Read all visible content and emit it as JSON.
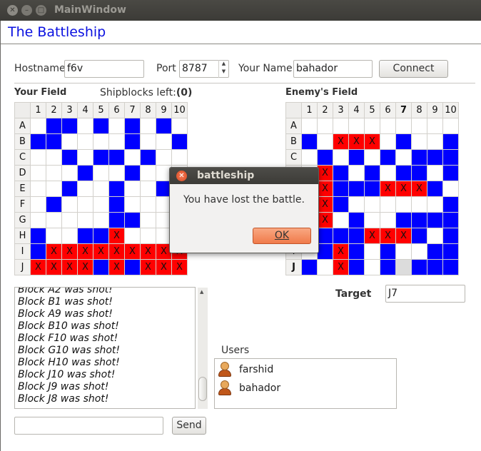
{
  "window": {
    "title": "MainWindow",
    "close_glyph": "✕",
    "min_glyph": "–",
    "max_glyph": "□"
  },
  "app": {
    "title": "The Battleship"
  },
  "connection": {
    "hostname_label": "Hostname",
    "hostname_value": "f6v",
    "port_label": "Port",
    "port_value": "8787",
    "name_label": "Your Name",
    "name_value": "bahador",
    "connect_label": "Connect"
  },
  "your_field": {
    "label": "Your Field",
    "shipblocks_label": "Shipblocks left:",
    "shipblocks_value": "(0)",
    "columns": [
      "1",
      "2",
      "3",
      "4",
      "5",
      "6",
      "7",
      "8",
      "9",
      "10"
    ],
    "rows": [
      "A",
      "B",
      "C",
      "D",
      "E",
      "F",
      "G",
      "H",
      "I",
      "J"
    ],
    "cells": [
      [
        "e",
        "s",
        "s",
        "e",
        "s",
        "e",
        "s",
        "e",
        "s",
        "e"
      ],
      [
        "s",
        "s",
        "e",
        "e",
        "e",
        "e",
        "s",
        "e",
        "e",
        "s"
      ],
      [
        "e",
        "e",
        "s",
        "e",
        "s",
        "s",
        "e",
        "s",
        "e",
        "e"
      ],
      [
        "e",
        "e",
        "e",
        "s",
        "e",
        "e",
        "s",
        "e",
        "e",
        "e"
      ],
      [
        "e",
        "e",
        "s",
        "e",
        "e",
        "s",
        "e",
        "e",
        "s",
        "s"
      ],
      [
        "e",
        "s",
        "e",
        "e",
        "e",
        "s",
        "e",
        "e",
        "e",
        "s"
      ],
      [
        "e",
        "e",
        "e",
        "e",
        "e",
        "s",
        "s",
        "e",
        "e",
        "s"
      ],
      [
        "s",
        "e",
        "e",
        "s",
        "s",
        "h",
        "e",
        "e",
        "e",
        "e"
      ],
      [
        "s",
        "h",
        "h",
        "h",
        "h",
        "h",
        "h",
        "h",
        "h",
        "h"
      ],
      [
        "h",
        "h",
        "h",
        "h",
        "s",
        "h",
        "s",
        "h",
        "h",
        "h"
      ]
    ]
  },
  "enemy_field": {
    "label": "Enemy's Field",
    "columns": [
      "1",
      "2",
      "3",
      "4",
      "5",
      "6",
      "7",
      "8",
      "9",
      "10"
    ],
    "rows": [
      "A",
      "B",
      "C",
      "D",
      "E",
      "F",
      "G",
      "H",
      "I",
      "J"
    ],
    "bold_col": 6,
    "bold_row": 9,
    "cells": [
      [
        "e",
        "e",
        "e",
        "e",
        "e",
        "e",
        "e",
        "e",
        "e",
        "e"
      ],
      [
        "s",
        "e",
        "h",
        "h",
        "h",
        "e",
        "s",
        "e",
        "e",
        "s"
      ],
      [
        "e",
        "s",
        "e",
        "s",
        "e",
        "s",
        "e",
        "s",
        "s",
        "s"
      ],
      [
        "e",
        "h",
        "s",
        "e",
        "s",
        "e",
        "s",
        "s",
        "e",
        "s"
      ],
      [
        "e",
        "h",
        "s",
        "s",
        "s",
        "h",
        "h",
        "h",
        "s",
        "e"
      ],
      [
        "e",
        "h",
        "s",
        "e",
        "e",
        "e",
        "e",
        "e",
        "e",
        "s"
      ],
      [
        "e",
        "h",
        "e",
        "s",
        "e",
        "e",
        "s",
        "s",
        "s",
        "s"
      ],
      [
        "e",
        "s",
        "s",
        "s",
        "h",
        "h",
        "h",
        "s",
        "e",
        "s"
      ],
      [
        "e",
        "s",
        "h",
        "s",
        "e",
        "s",
        "e",
        "e",
        "s",
        "s"
      ],
      [
        "s",
        "e",
        "h",
        "s",
        "e",
        "s",
        "m",
        "s",
        "s",
        "s"
      ]
    ]
  },
  "marks": {
    "hit": "X"
  },
  "log": {
    "lines": [
      "Block A2 was shot!",
      "Block B1 was shot!",
      "Block A9 was shot!",
      "Block B10 was shot!",
      "Block F10 was shot!",
      "Block G10 was shot!",
      "Block H10 was shot!",
      "Block J10 was shot!",
      "Block J9 was shot!",
      "Block J8 was shot!"
    ]
  },
  "target": {
    "label": "Target",
    "value": "J7"
  },
  "users": {
    "label": "Users",
    "list": [
      "farshid",
      "bahador"
    ]
  },
  "chat": {
    "input_value": "",
    "send_label": "Send"
  },
  "dialog": {
    "title": "battleship",
    "message": "You have lost the battle.",
    "ok_label": "OK",
    "close_glyph": "✕"
  },
  "colors": {
    "ship": "#0000ff",
    "hit": "#ff0000",
    "miss": "#dcdcdc",
    "title_blue": "#0a10e0"
  }
}
